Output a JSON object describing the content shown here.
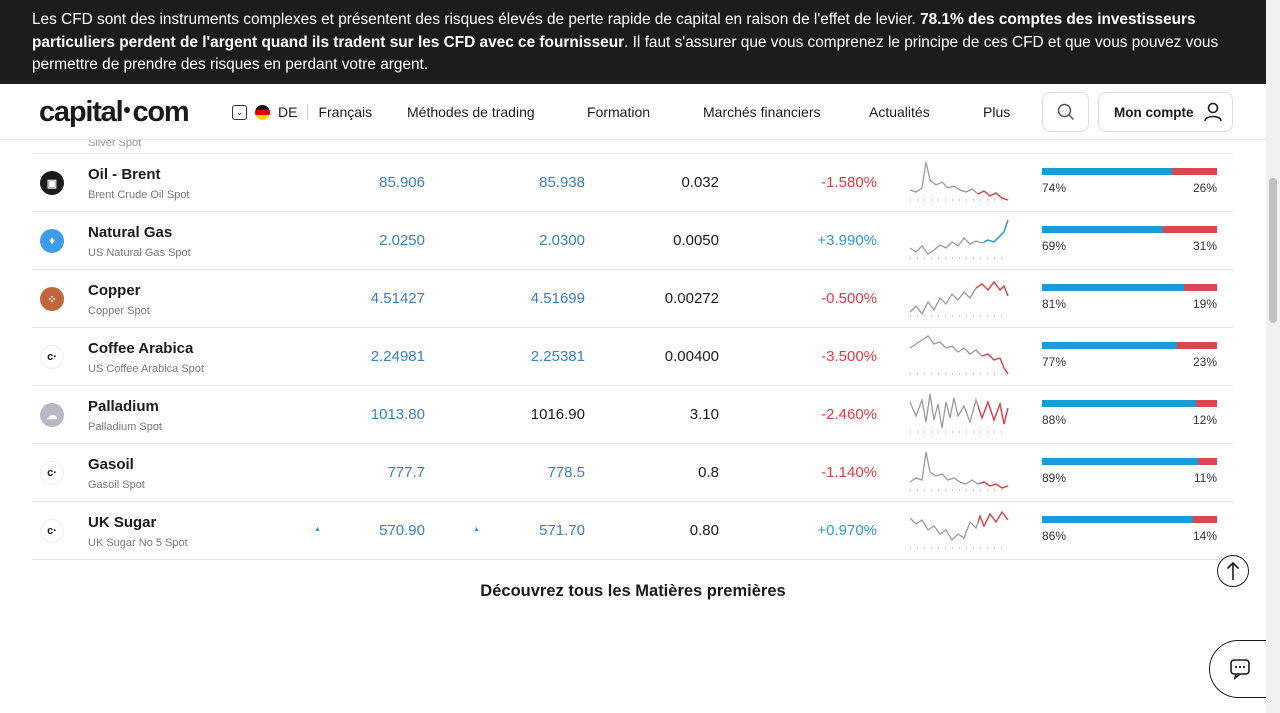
{
  "banner": {
    "text_pre": "Les CFD sont des instruments complexes et présentent des risques élevés de perte rapide de capital en raison de l'effet de levier. ",
    "text_bold": "78.1% des comptes des investisseurs particuliers perdent de l'argent quand ils tradent sur les CFD avec ce fournisseur",
    "text_post": ". Il faut s'assurer que vous comprenez le principe de ces CFD et que vous pouvez vous permettre de prendre des risques en perdant votre argent."
  },
  "nav": {
    "logo": {
      "left": "capital",
      "right": "com"
    },
    "country": "DE",
    "language": "Français",
    "menu": [
      "Méthodes de trading",
      "Formation",
      "Marchés financiers",
      "Actualités",
      "Plus"
    ],
    "account": "Mon compte"
  },
  "rows": [
    {
      "name": "Oil - Brent",
      "sub": "Brent Crude Oil Spot",
      "sell": "85.906",
      "buy": "85.938",
      "spread": "0.032",
      "change": "-1.580%",
      "dir": "neg",
      "buyers": "74%",
      "sellers": "26%",
      "buyers_frac": 0.74,
      "icon_bg": "#1b1b1b",
      "icon": "fuel-icon"
    },
    {
      "name": "Natural Gas",
      "sub": "US Natural Gas Spot",
      "sell": "2.0250",
      "buy": "2.0300",
      "spread": "0.0050",
      "change": "+3.990%",
      "dir": "pos",
      "buyers": "69%",
      "sellers": "31%",
      "buyers_frac": 0.69,
      "icon_bg": "#3f9ce8",
      "icon": "flame-icon"
    },
    {
      "name": "Copper",
      "sub": "Copper Spot",
      "sell": "4.51427",
      "buy": "4.51699",
      "spread": "0.00272",
      "change": "-0.500%",
      "dir": "neg",
      "buyers": "81%",
      "sellers": "19%",
      "buyers_frac": 0.81,
      "icon_bg": "#c0653e",
      "icon": "copper-icon"
    },
    {
      "name": "Coffee Arabica",
      "sub": "US Coffee Arabica Spot",
      "sell": "2.24981",
      "buy": "2.25381",
      "spread": "0.00400",
      "change": "-3.500%",
      "dir": "neg",
      "buyers": "77%",
      "sellers": "23%",
      "buyers_frac": 0.77,
      "icon_bg": "#ffffff",
      "icon": "capital-c-icon"
    },
    {
      "name": "Palladium",
      "sub": "Palladium Spot",
      "sell": "1013.80",
      "buy": "1016.90",
      "spread": "3.10",
      "change": "-2.460%",
      "dir": "neg",
      "buyers": "88%",
      "sellers": "12%",
      "buyers_frac": 0.88,
      "icon_bg": "#b8b8c4",
      "icon": "palladium-icon",
      "buy_black": true
    },
    {
      "name": "Gasoil",
      "sub": "Gasoil Spot",
      "sell": "777.7",
      "buy": "778.5",
      "spread": "0.8",
      "change": "-1.140%",
      "dir": "neg",
      "buyers": "89%",
      "sellers": "11%",
      "buyers_frac": 0.89,
      "icon_bg": "#ffffff",
      "icon": "capital-c-icon"
    },
    {
      "name": "UK Sugar",
      "sub": "UK Sugar No 5 Spot",
      "sell": "570.90",
      "buy": "571.70",
      "spread": "0.80",
      "change": "+0.970%",
      "dir": "pos",
      "buyers": "86%",
      "sellers": "14%",
      "buyers_frac": 0.86,
      "icon_bg": "#ffffff",
      "icon": "capital-c-icon",
      "arrows": true
    }
  ],
  "partial_row_sub": "Silver Spot",
  "discover": "Découvrez tous les Matières premières"
}
